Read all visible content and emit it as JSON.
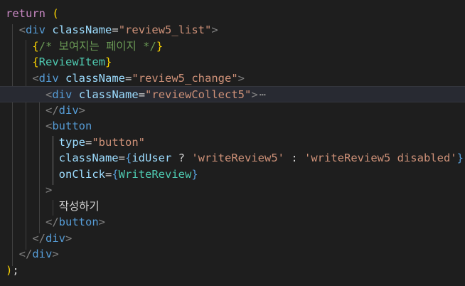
{
  "code": {
    "l1": {
      "kw": "return",
      "paren": "("
    },
    "l2": {
      "open": "<",
      "tag": "div",
      "attr": "className",
      "eq": "=",
      "val": "\"review5_list\"",
      "close": ">"
    },
    "l3": {
      "ob": "{",
      "comment": "/* 보여지는 페이지 */",
      "cb": "}"
    },
    "l4": {
      "ob": "{",
      "comp": "ReviewItem",
      "cb": "}"
    },
    "l5": {
      "open": "<",
      "tag": "div",
      "attr": "className",
      "eq": "=",
      "val": "\"review5_change\"",
      "close": ">"
    },
    "l6": {
      "open": "<",
      "tag": "div",
      "attr": "className",
      "eq": "=",
      "val": "\"reviewCollect5\"",
      "close": ">",
      "fold": "⋯"
    },
    "l7": {
      "open": "</",
      "tag": "div",
      "close": ">"
    },
    "l8": {
      "open": "<",
      "tag": "button"
    },
    "l9": {
      "attr": "type",
      "eq": "=",
      "val": "\"button\""
    },
    "l10": {
      "attr": "className",
      "eq": "=",
      "ob": "{",
      "var": "idUser",
      "q": " ? ",
      "s1": "'writeReview5'",
      "colon": " : ",
      "s2": "'writeReview5 disabled'",
      "cb": "}"
    },
    "l11": {
      "attr": "onClick",
      "eq": "=",
      "ob": "{",
      "fn": "WriteReview",
      "cb": "}"
    },
    "l12": {
      "close": ">"
    },
    "l13": {
      "text": "작성하기"
    },
    "l14": {
      "open": "</",
      "tag": "button",
      "close": ">"
    },
    "l15": {
      "open": "</",
      "tag": "div",
      "close": ">"
    },
    "l16": {
      "open": "</",
      "tag": "div",
      "close": ">"
    },
    "l17": {
      "paren": ")",
      "semi": ";"
    }
  },
  "colors": {
    "background": "#1e1e1e",
    "keyword": "#c586c0",
    "tag": "#569cd6",
    "attribute": "#9cdcfe",
    "string": "#ce9178",
    "comment": "#6a9955",
    "bracket_gold": "#ffd700",
    "component": "#4ec9b0"
  }
}
